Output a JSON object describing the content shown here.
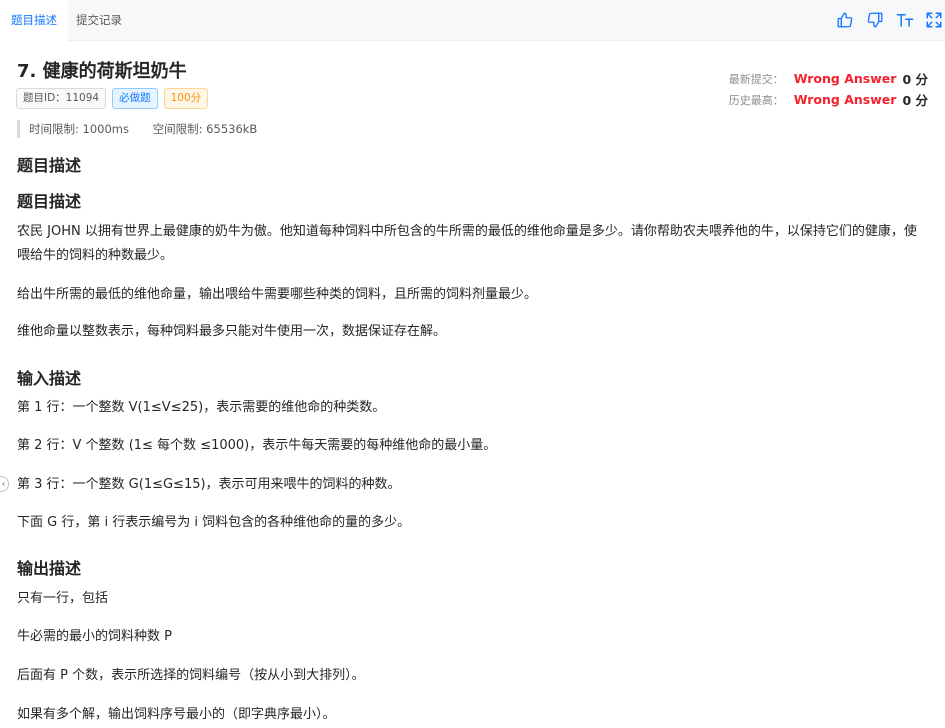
{
  "tabs": [
    {
      "label": "题目描述"
    },
    {
      "label": "提交记录"
    }
  ],
  "toolbar": {
    "icons": [
      "thumbs-up-icon",
      "thumbs-down-icon",
      "font-size-icon",
      "fullscreen-icon"
    ],
    "accent": "#1677ff"
  },
  "problem": {
    "title": "7.  健康的荷斯坦奶牛",
    "tags": [
      "题目ID：11094",
      "必做题",
      "100分"
    ],
    "latest_label": "最新提交：",
    "latest_verdict": "Wrong Answer",
    "latest_score": "0 分",
    "best_label": "历史最高：",
    "best_verdict": "Wrong Answer",
    "best_score": "0 分",
    "time_limit": "时间限制: 1000ms",
    "memory_limit": "空间限制: 65536kB"
  },
  "content": {
    "h_desc1": "题目描述",
    "h_desc2": "题目描述",
    "desc_p1": "农民 JOHN 以拥有世界上最健康的奶牛为傲。他知道每种饲料中所包含的牛所需的最低的维他命量是多少。请你帮助农夫喂养他的牛，以保持它们的健康，使喂给牛的饲料的种数最少。",
    "desc_p2": "给出牛所需的最低的维他命量，输出喂给牛需要哪些种类的饲料，且所需的饲料剂量最少。",
    "desc_p3": "维他命量以整数表示，每种饲料最多只能对牛使用一次，数据保证存在解。",
    "h_input": "输入描述",
    "in_p1": "第 1 行：一个整数 V(1≤V≤25)，表示需要的维他命的种类数。",
    "in_p2": "第 2 行：V 个整数 (1≤ 每个数 ≤1000)，表示牛每天需要的每种维他命的最小量。",
    "in_p3": "第 3 行：一个整数 G(1≤G≤15)，表示可用来喂牛的饲料的种数。",
    "in_p4": "下面 G 行，第 i 行表示编号为 i 饲料包含的各种维他命的量的多少。",
    "h_output": "输出描述",
    "out_p1": "只有一行，包括",
    "out_p2": "牛必需的最小的饲料种数 P",
    "out_p3": "后面有 P 个数，表示所选择的饲料编号（按从小到大排列）。",
    "out_p4": "如果有多个解，输出饲料序号最小的（即字典序最小）。"
  },
  "colors": {
    "verdict": "#f5222d",
    "tab_active": "#1677ff"
  }
}
